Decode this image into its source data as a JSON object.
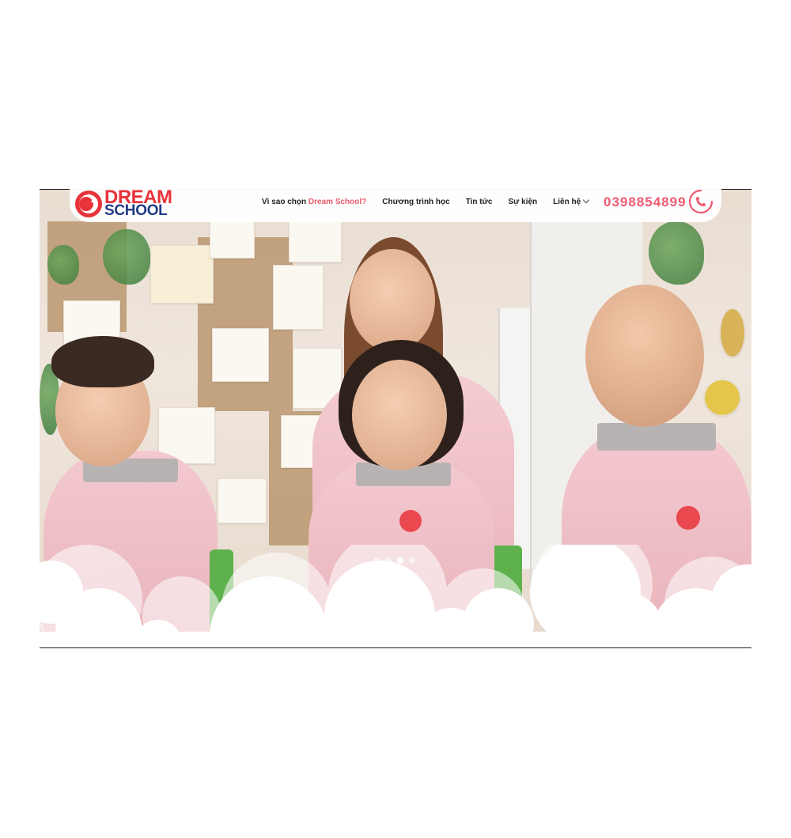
{
  "brand": {
    "line1": "DREAM",
    "line2": "SCHOOL",
    "primary_color": "#e8333a",
    "secondary_color": "#1f3a86"
  },
  "nav": {
    "why_prefix": "Vì sao chọn",
    "why_highlight": "Dream School?",
    "program": "Chương trình học",
    "news": "Tin tức",
    "events": "Sự kiện",
    "contact": "Liên hệ"
  },
  "contact": {
    "phone": "0398854899",
    "phone_icon": "phone-icon",
    "accent_color": "#ef5a70"
  },
  "slider": {
    "slide_count": 4,
    "active_index": 2
  }
}
